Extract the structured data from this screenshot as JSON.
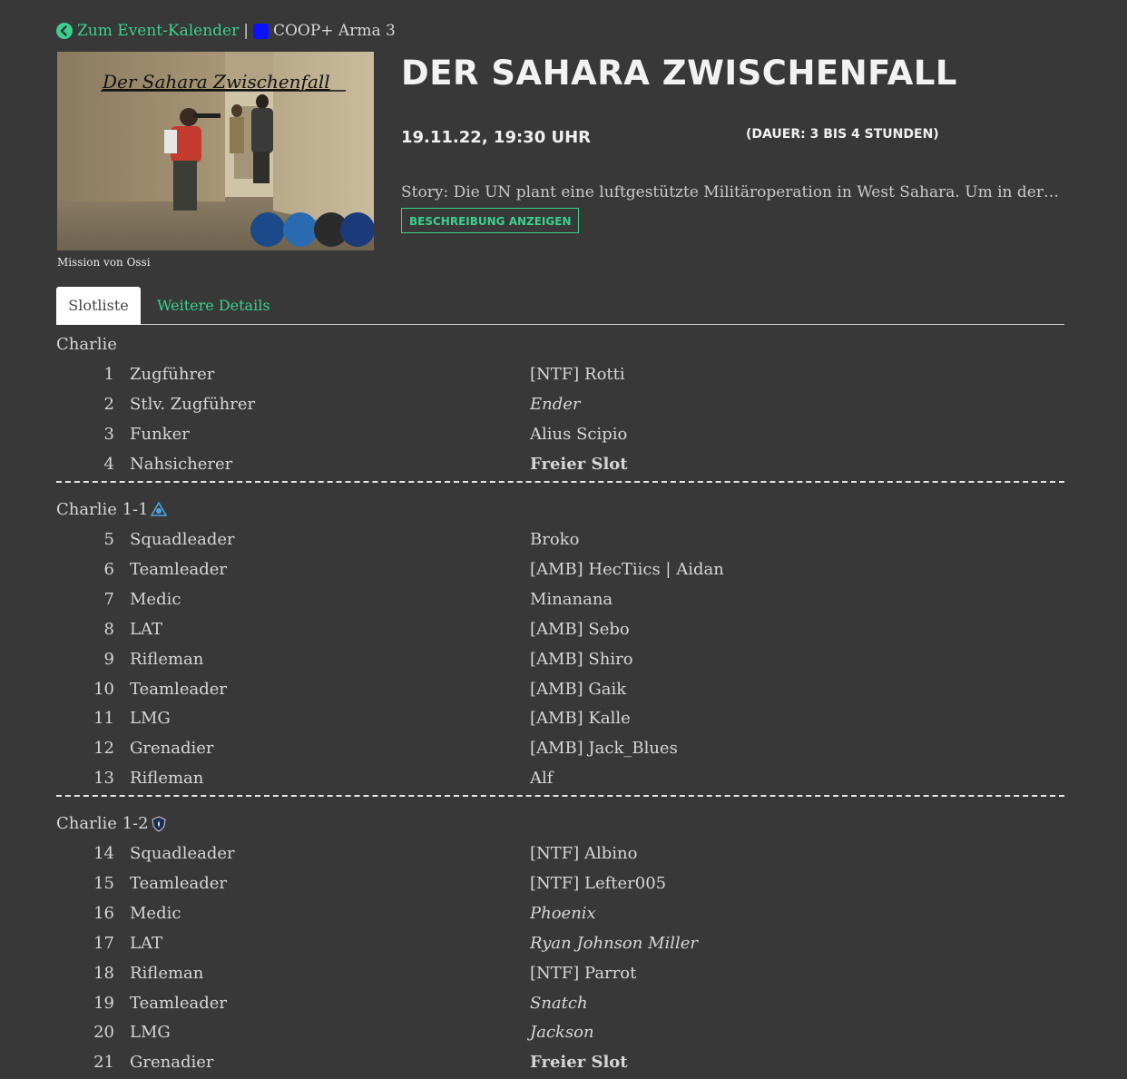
{
  "nav": {
    "back_label": "Zum Event-Kalender",
    "separator": "|",
    "event_type": "COOP+ Arma 3",
    "event_type_color": "#0a12ff"
  },
  "event": {
    "image_title": "Der Sahara Zwischenfall",
    "image_caption": "Mission von Ossi",
    "title": "DER SAHARA ZWISCHENFALL",
    "date": "19.11.22, 19:30 UHR",
    "duration": "(DAUER: 3 BIS 4 STUNDEN)",
    "story": "Story: Die UN plant eine luftgestützte Militäroperation in West Sahara. Um in der Region die Kontrolle zu übernehmen",
    "description_button": "BESCHREIBUNG ANZEIGEN"
  },
  "tabs": [
    {
      "label": "Slotliste",
      "active": true
    },
    {
      "label": "Weitere Details",
      "active": false
    }
  ],
  "groups": [
    {
      "name": "Charlie",
      "icon": null,
      "slots": [
        {
          "num": "1",
          "role": "Zugführer",
          "player": "[NTF] Rotti",
          "style": "normal"
        },
        {
          "num": "2",
          "role": "Stlv. Zugführer",
          "player": "Ender",
          "style": "italic"
        },
        {
          "num": "3",
          "role": "Funker",
          "player": "Alius Scipio",
          "style": "normal"
        },
        {
          "num": "4",
          "role": "Nahsicherer",
          "player": "Freier Slot",
          "style": "free"
        }
      ]
    },
    {
      "name": "Charlie 1-1",
      "icon": "amb-logo-icon",
      "slots": [
        {
          "num": "5",
          "role": "Squadleader",
          "player": "Broko",
          "style": "normal"
        },
        {
          "num": "6",
          "role": "Teamleader",
          "player": "[AMB] HecTiics | Aidan",
          "style": "normal"
        },
        {
          "num": "7",
          "role": "Medic",
          "player": "Minanana",
          "style": "normal"
        },
        {
          "num": "8",
          "role": "LAT",
          "player": "[AMB] Sebo",
          "style": "normal"
        },
        {
          "num": "9",
          "role": "Rifleman",
          "player": "[AMB] Shiro",
          "style": "normal"
        },
        {
          "num": "10",
          "role": "Teamleader",
          "player": "[AMB] Gaik",
          "style": "normal"
        },
        {
          "num": "11",
          "role": "LMG",
          "player": "[AMB] Kalle",
          "style": "normal"
        },
        {
          "num": "12",
          "role": "Grenadier",
          "player": "[AMB] Jack_Blues",
          "style": "normal"
        },
        {
          "num": "13",
          "role": "Rifleman",
          "player": "Alf",
          "style": "normal"
        }
      ]
    },
    {
      "name": "Charlie 1-2",
      "icon": "ntf-shield-icon",
      "slots": [
        {
          "num": "14",
          "role": "Squadleader",
          "player": "[NTF] Albino",
          "style": "normal"
        },
        {
          "num": "15",
          "role": "Teamleader",
          "player": "[NTF] Lefter005",
          "style": "normal"
        },
        {
          "num": "16",
          "role": "Medic",
          "player": "Phoenix",
          "style": "italic"
        },
        {
          "num": "17",
          "role": "LAT",
          "player": "Ryan Johnson Miller",
          "style": "italic"
        },
        {
          "num": "18",
          "role": "Rifleman",
          "player": "[NTF] Parrot",
          "style": "normal"
        },
        {
          "num": "19",
          "role": "Teamleader",
          "player": "Snatch",
          "style": "italic"
        },
        {
          "num": "20",
          "role": "LMG",
          "player": "Jackson",
          "style": "italic"
        },
        {
          "num": "21",
          "role": "Grenadier",
          "player": "Freier Slot",
          "style": "free"
        }
      ]
    }
  ]
}
